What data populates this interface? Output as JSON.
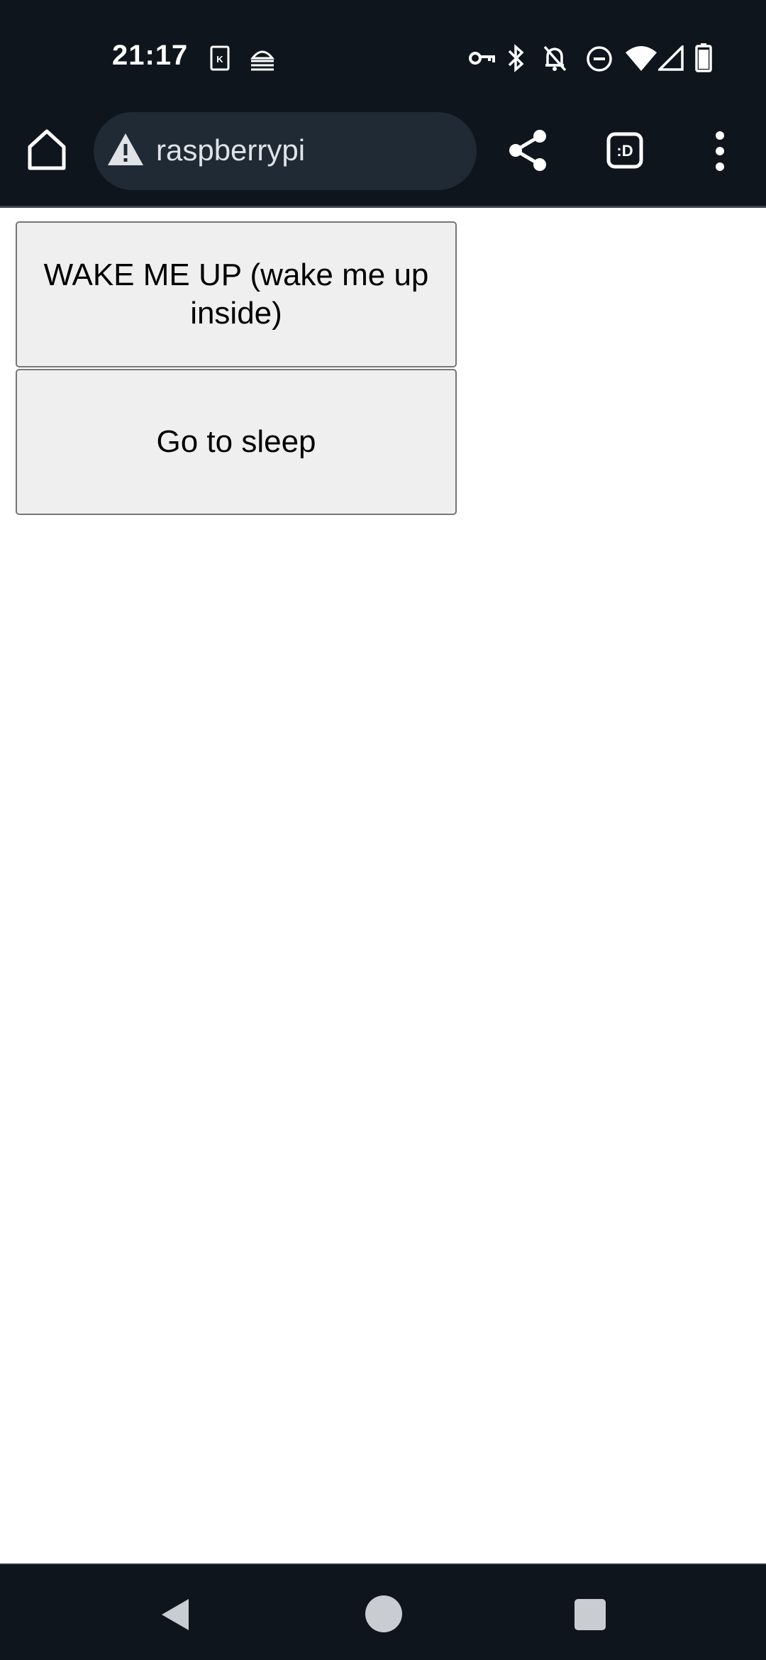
{
  "status_bar": {
    "time": "21:17",
    "icons": [
      "kindle-icon",
      "android-debug-icon",
      "vpn-key-icon",
      "bluetooth-icon",
      "alarm-off-icon",
      "do-not-disturb-icon",
      "wifi-icon",
      "cell-signal-icon",
      "battery-icon"
    ]
  },
  "browser": {
    "url": "raspberrypi",
    "tabs_label": ":D",
    "icons": [
      "home-icon",
      "warning-icon",
      "share-icon",
      "tabs-icon",
      "more-vert-icon"
    ]
  },
  "page": {
    "wake_button_label": "WAKE ME UP (wake me up inside)",
    "sleep_button_label": "Go to sleep"
  },
  "nav_bar": {
    "icons": [
      "back-icon",
      "home-nav-icon",
      "recents-icon"
    ]
  },
  "colors": {
    "chrome_background": "#0f151d",
    "omnibox_background": "#1f2a34",
    "button_background": "#efefef",
    "button_border": "#767676"
  }
}
